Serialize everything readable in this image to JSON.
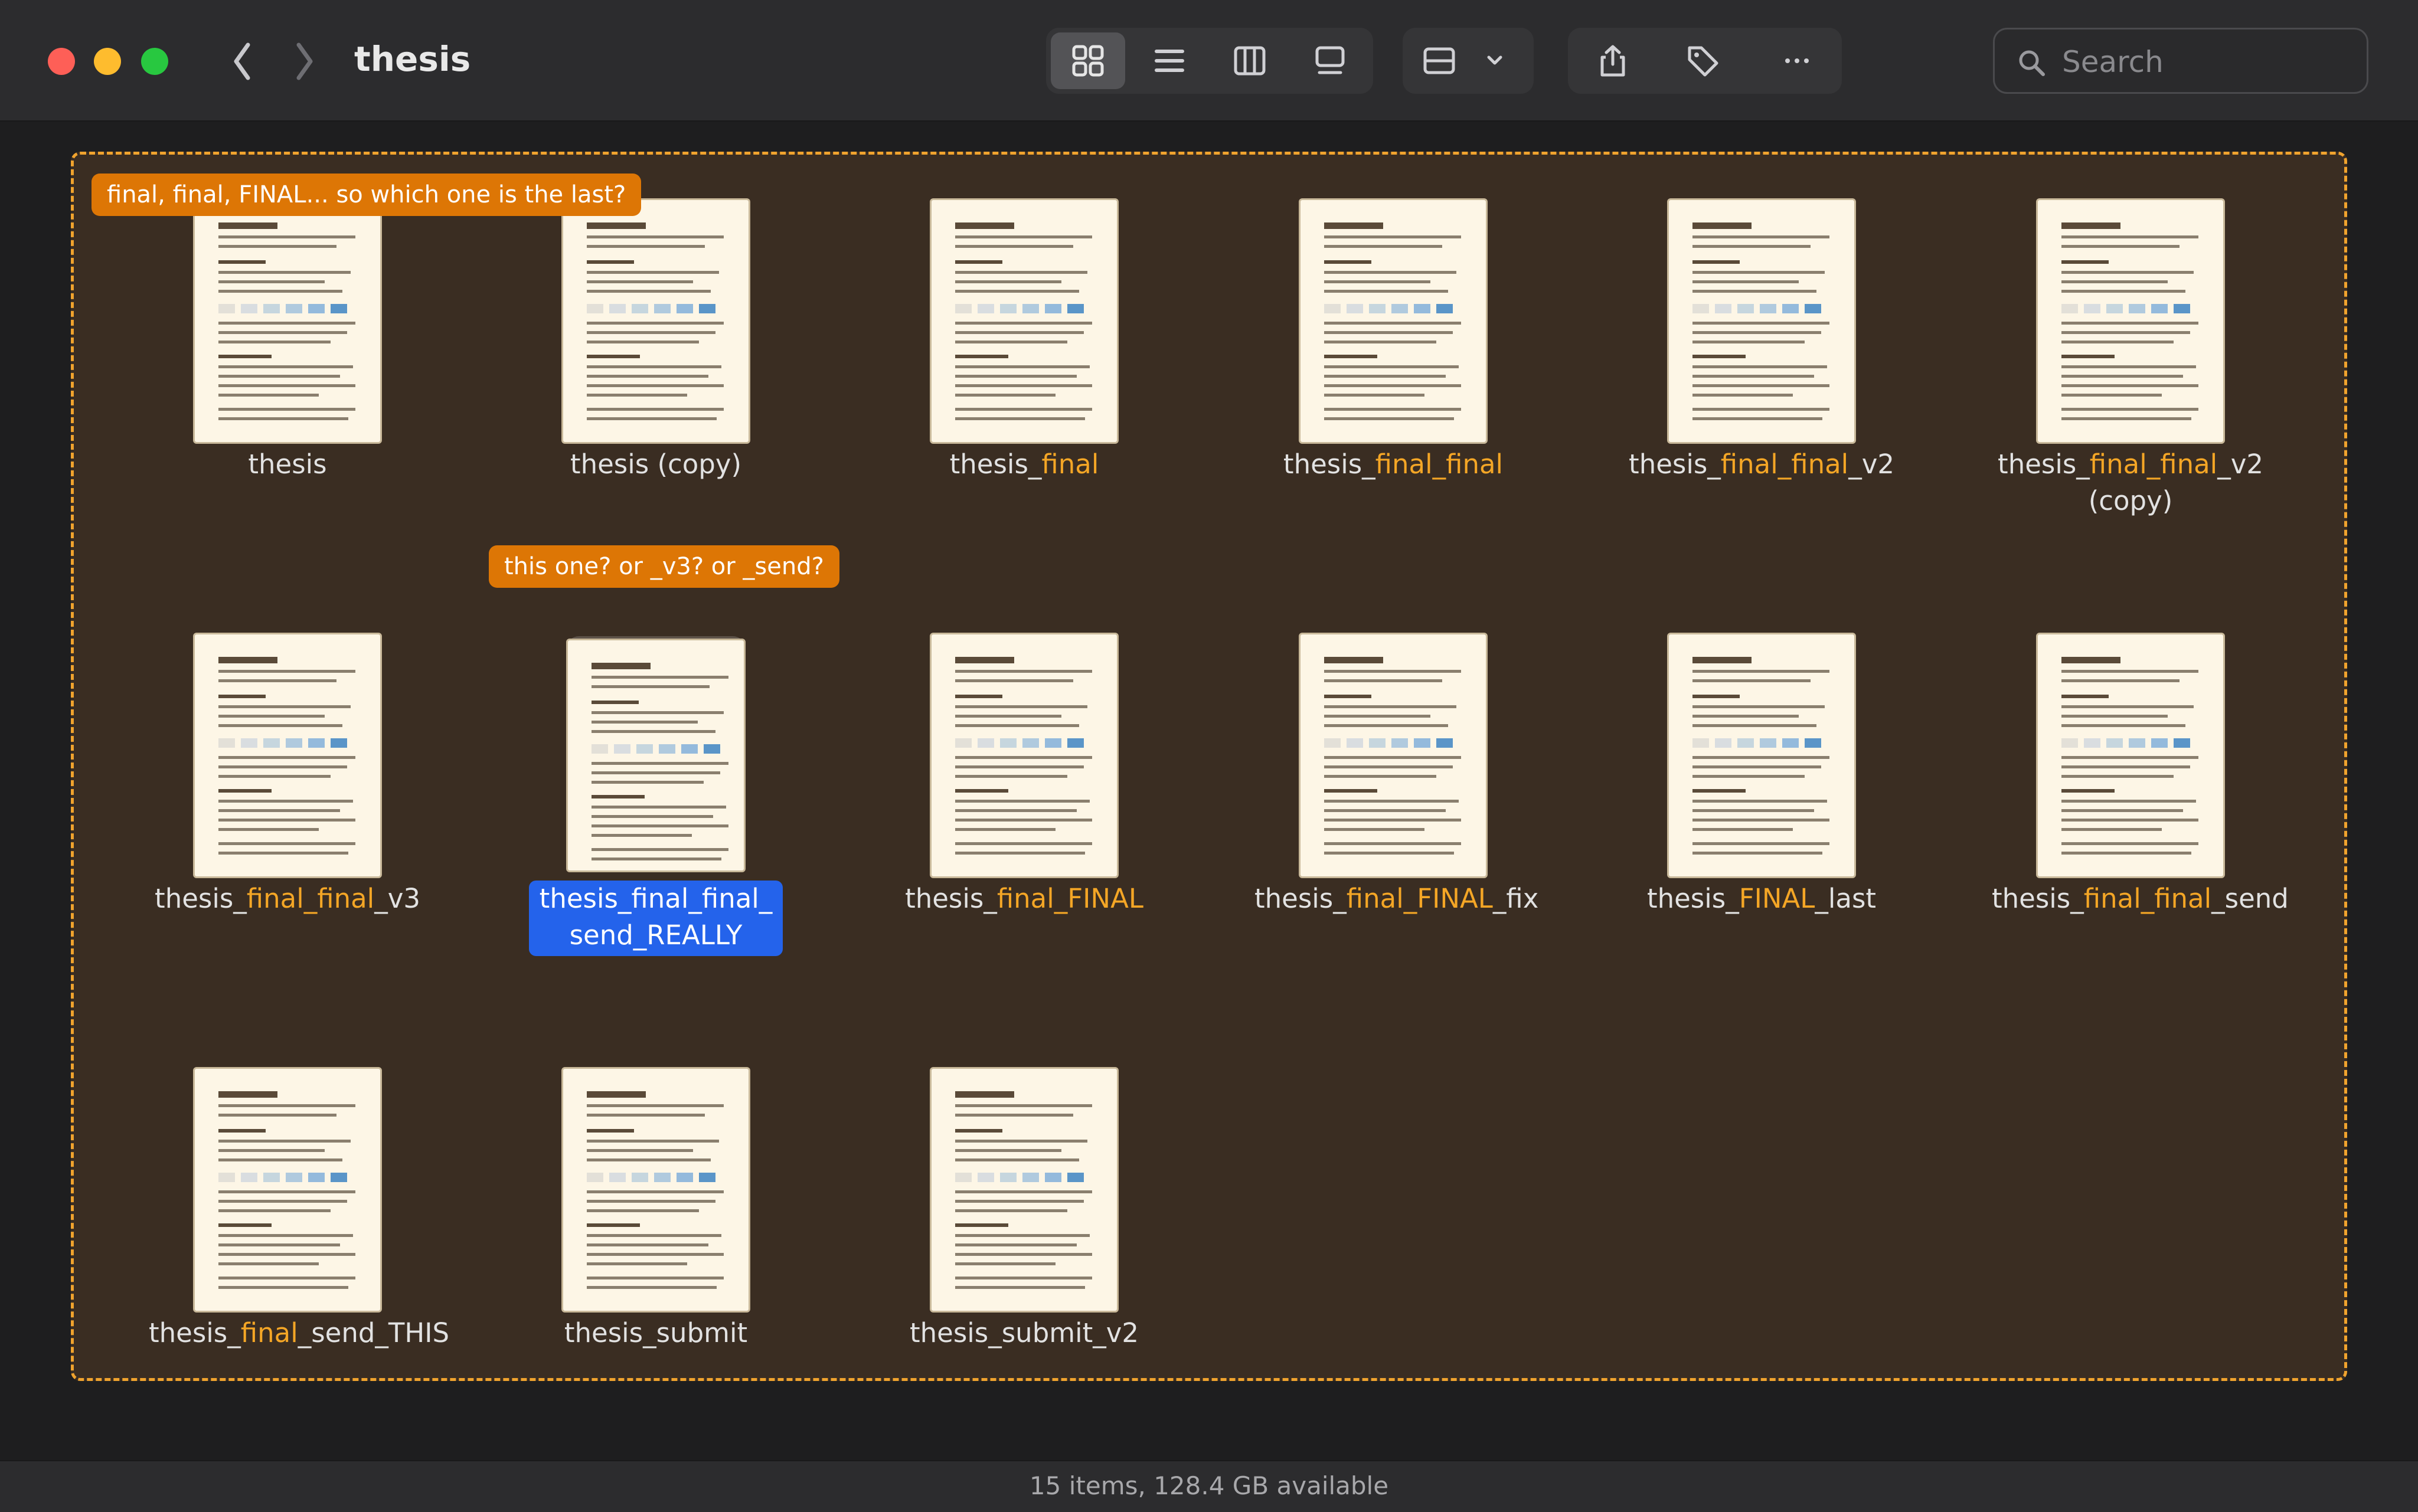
{
  "window": {
    "title": "thesis",
    "search_placeholder": "Search"
  },
  "toolbar": {
    "back_icon": "chevron-left-icon",
    "forward_icon": "chevron-right-icon",
    "view_modes": [
      "icons-view",
      "list-view",
      "columns-view",
      "gallery-view"
    ],
    "active_view": "icons-view",
    "group_icon": "group-icon",
    "actions": [
      "share-icon",
      "tag-icon",
      "more-icon"
    ]
  },
  "notes": [
    "final, final, FINAL... so which one is the last?",
    "this one? or _v3? or _send?"
  ],
  "files": [
    {
      "name": "thesis",
      "parts": [
        {
          "t": "thesis",
          "h": false
        }
      ]
    },
    {
      "name": "thesis (copy)",
      "parts": [
        {
          "t": "thesis (copy)",
          "h": false
        }
      ]
    },
    {
      "name": "thesis_final",
      "parts": [
        {
          "t": "thesis_",
          "h": false
        },
        {
          "t": "final",
          "h": true
        }
      ]
    },
    {
      "name": "thesis_final_final",
      "parts": [
        {
          "t": "thesis_",
          "h": false
        },
        {
          "t": "final_final",
          "h": true
        }
      ]
    },
    {
      "name": "thesis_final_final_v2",
      "parts": [
        {
          "t": "thesis_",
          "h": false
        },
        {
          "t": "final_final",
          "h": true
        },
        {
          "t": "_v2",
          "h": false
        }
      ]
    },
    {
      "name": "thesis_final_final_v2 (copy)",
      "parts": [
        {
          "t": "thesis_",
          "h": false
        },
        {
          "t": "final_final",
          "h": true
        },
        {
          "t": "_v2 (copy)",
          "h": false
        }
      ]
    },
    {
      "name": "thesis_final_final_v3",
      "parts": [
        {
          "t": "thesis_",
          "h": false
        },
        {
          "t": "final_final",
          "h": true
        },
        {
          "t": "_v3",
          "h": false
        }
      ]
    },
    {
      "name": "thesis_final_final_send_REALLY",
      "selected": true,
      "label_line1": "thesis_final_final_",
      "label_line2": "send_REALLY",
      "parts": []
    },
    {
      "name": "thesis_final_FINAL",
      "parts": [
        {
          "t": "thesis_",
          "h": false
        },
        {
          "t": "final_FINAL",
          "h": true
        }
      ]
    },
    {
      "name": "thesis_final_FINAL_fix",
      "parts": [
        {
          "t": "thesis_",
          "h": false
        },
        {
          "t": "final_FINAL",
          "h": true
        },
        {
          "t": "_fix",
          "h": false
        }
      ]
    },
    {
      "name": "thesis_FINAL_last",
      "parts": [
        {
          "t": "thesis_",
          "h": false
        },
        {
          "t": "FINAL",
          "h": true
        },
        {
          "t": "_last",
          "h": false
        }
      ]
    },
    {
      "name": "thesis_final_final_send",
      "parts": [
        {
          "t": "thesis_",
          "h": false
        },
        {
          "t": "final_final",
          "h": true
        },
        {
          "t": "_send",
          "h": false
        }
      ]
    },
    {
      "name": "thesis_final_send_THIS",
      "parts": [
        {
          "t": "thesis_",
          "h": false
        },
        {
          "t": "final",
          "h": true
        },
        {
          "t": "_send_THIS",
          "h": false
        }
      ]
    },
    {
      "name": "thesis_submit",
      "parts": [
        {
          "t": "thesis_submit",
          "h": false
        }
      ]
    },
    {
      "name": "thesis_submit_v2",
      "parts": [
        {
          "t": "thesis_submit_v2",
          "h": false
        }
      ]
    }
  ],
  "colors": {
    "highlight": "#f4a626",
    "note_bg": "#dd7605",
    "selection": "#2463eb",
    "drop_border": "#f0a32e"
  },
  "status": {
    "text": "15 items, 128.4 GB available"
  }
}
